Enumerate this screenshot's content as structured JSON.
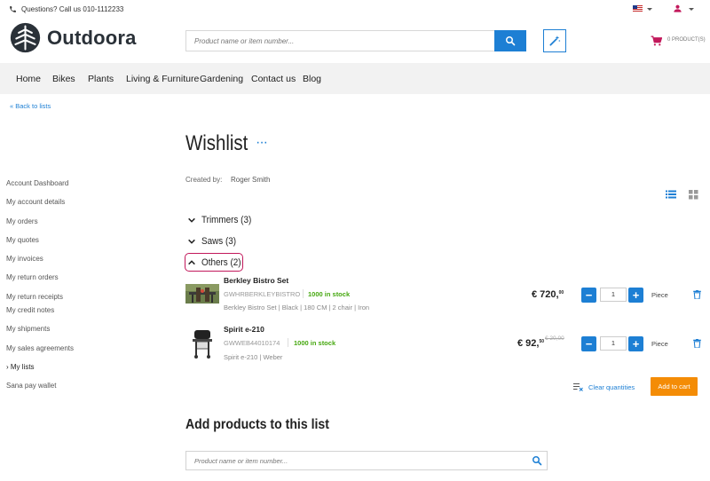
{
  "topbar": {
    "phone_text": "Questions? Call us 010-1112233"
  },
  "header": {
    "brand": "Outdoora",
    "search_placeholder": "Product name or item number...",
    "cart_text": "0 PRODUCT(S)"
  },
  "nav": {
    "items": [
      "Home",
      "Bikes",
      "Plants",
      "Living & Furniture",
      "Gardening",
      "Contact us",
      "Blog"
    ]
  },
  "back_link": "« Back to lists",
  "sidebar": {
    "items": [
      "Account Dashboard",
      "My account details",
      "My orders",
      "My quotes",
      "My invoices",
      "My return orders",
      "My return receipts",
      "My credit notes",
      "My shipments",
      "My sales agreements",
      "› My lists",
      "Sana pay wallet"
    ]
  },
  "wishlist": {
    "title": "Wishlist",
    "more": "···",
    "created_by_label": "Created by:",
    "created_by_value": "Roger Smith",
    "groups": [
      "Trimmers (3)",
      "Saws (3)",
      "Others (2)"
    ],
    "products": [
      {
        "name": "Berkley Bistro Set",
        "code": "GWHRBERKLEYBISTRO",
        "stock": "1000 in stock",
        "description": "Berkley Bistro Set | Black | 180 CM | 2 chair | Iron",
        "price_main": "€ 720,",
        "price_cents": "00",
        "old_price": "",
        "quantity": "1",
        "unit": "Piece"
      },
      {
        "name": "Spirit e-210",
        "code": "GWWEB44010174",
        "stock": "1000 in stock",
        "description": "Spirit e-210 | Weber",
        "price_main": "€ 92,",
        "price_cents": "50",
        "old_price": "€ 20,00",
        "quantity": "1",
        "unit": "Piece"
      }
    ],
    "clear_quantities": "Clear quantities",
    "add_to_cart": "Add to cart"
  },
  "add_products": {
    "title": "Add products to this list",
    "placeholder": "Product name or item number..."
  },
  "colors": {
    "accent": "#1d7fd4",
    "stock": "#46a810",
    "add_to_cart": "#f48c06",
    "highlight": "#c2185b",
    "nav_bg": "#f2f2f2"
  }
}
